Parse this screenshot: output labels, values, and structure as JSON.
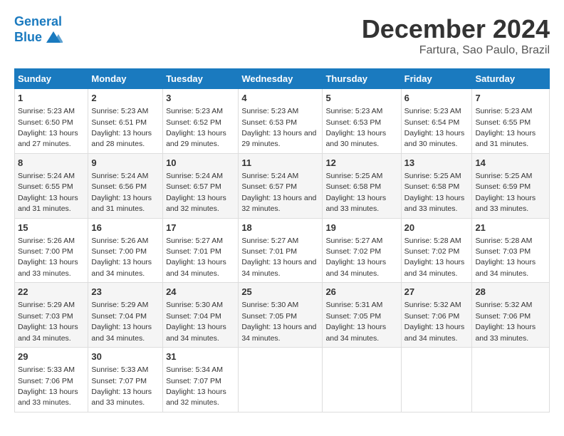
{
  "logo": {
    "line1": "General",
    "line2": "Blue"
  },
  "title": "December 2024",
  "subtitle": "Fartura, Sao Paulo, Brazil",
  "weekdays": [
    "Sunday",
    "Monday",
    "Tuesday",
    "Wednesday",
    "Thursday",
    "Friday",
    "Saturday"
  ],
  "weeks": [
    [
      {
        "day": 1,
        "sunrise": "5:23 AM",
        "sunset": "6:50 PM",
        "daylight": "13 hours and 27 minutes."
      },
      {
        "day": 2,
        "sunrise": "5:23 AM",
        "sunset": "6:51 PM",
        "daylight": "13 hours and 28 minutes."
      },
      {
        "day": 3,
        "sunrise": "5:23 AM",
        "sunset": "6:52 PM",
        "daylight": "13 hours and 29 minutes."
      },
      {
        "day": 4,
        "sunrise": "5:23 AM",
        "sunset": "6:53 PM",
        "daylight": "13 hours and 29 minutes."
      },
      {
        "day": 5,
        "sunrise": "5:23 AM",
        "sunset": "6:53 PM",
        "daylight": "13 hours and 30 minutes."
      },
      {
        "day": 6,
        "sunrise": "5:23 AM",
        "sunset": "6:54 PM",
        "daylight": "13 hours and 30 minutes."
      },
      {
        "day": 7,
        "sunrise": "5:23 AM",
        "sunset": "6:55 PM",
        "daylight": "13 hours and 31 minutes."
      }
    ],
    [
      {
        "day": 8,
        "sunrise": "5:24 AM",
        "sunset": "6:55 PM",
        "daylight": "13 hours and 31 minutes."
      },
      {
        "day": 9,
        "sunrise": "5:24 AM",
        "sunset": "6:56 PM",
        "daylight": "13 hours and 31 minutes."
      },
      {
        "day": 10,
        "sunrise": "5:24 AM",
        "sunset": "6:57 PM",
        "daylight": "13 hours and 32 minutes."
      },
      {
        "day": 11,
        "sunrise": "5:24 AM",
        "sunset": "6:57 PM",
        "daylight": "13 hours and 32 minutes."
      },
      {
        "day": 12,
        "sunrise": "5:25 AM",
        "sunset": "6:58 PM",
        "daylight": "13 hours and 33 minutes."
      },
      {
        "day": 13,
        "sunrise": "5:25 AM",
        "sunset": "6:58 PM",
        "daylight": "13 hours and 33 minutes."
      },
      {
        "day": 14,
        "sunrise": "5:25 AM",
        "sunset": "6:59 PM",
        "daylight": "13 hours and 33 minutes."
      }
    ],
    [
      {
        "day": 15,
        "sunrise": "5:26 AM",
        "sunset": "7:00 PM",
        "daylight": "13 hours and 33 minutes."
      },
      {
        "day": 16,
        "sunrise": "5:26 AM",
        "sunset": "7:00 PM",
        "daylight": "13 hours and 34 minutes."
      },
      {
        "day": 17,
        "sunrise": "5:27 AM",
        "sunset": "7:01 PM",
        "daylight": "13 hours and 34 minutes."
      },
      {
        "day": 18,
        "sunrise": "5:27 AM",
        "sunset": "7:01 PM",
        "daylight": "13 hours and 34 minutes."
      },
      {
        "day": 19,
        "sunrise": "5:27 AM",
        "sunset": "7:02 PM",
        "daylight": "13 hours and 34 minutes."
      },
      {
        "day": 20,
        "sunrise": "5:28 AM",
        "sunset": "7:02 PM",
        "daylight": "13 hours and 34 minutes."
      },
      {
        "day": 21,
        "sunrise": "5:28 AM",
        "sunset": "7:03 PM",
        "daylight": "13 hours and 34 minutes."
      }
    ],
    [
      {
        "day": 22,
        "sunrise": "5:29 AM",
        "sunset": "7:03 PM",
        "daylight": "13 hours and 34 minutes."
      },
      {
        "day": 23,
        "sunrise": "5:29 AM",
        "sunset": "7:04 PM",
        "daylight": "13 hours and 34 minutes."
      },
      {
        "day": 24,
        "sunrise": "5:30 AM",
        "sunset": "7:04 PM",
        "daylight": "13 hours and 34 minutes."
      },
      {
        "day": 25,
        "sunrise": "5:30 AM",
        "sunset": "7:05 PM",
        "daylight": "13 hours and 34 minutes."
      },
      {
        "day": 26,
        "sunrise": "5:31 AM",
        "sunset": "7:05 PM",
        "daylight": "13 hours and 34 minutes."
      },
      {
        "day": 27,
        "sunrise": "5:32 AM",
        "sunset": "7:06 PM",
        "daylight": "13 hours and 34 minutes."
      },
      {
        "day": 28,
        "sunrise": "5:32 AM",
        "sunset": "7:06 PM",
        "daylight": "13 hours and 33 minutes."
      }
    ],
    [
      {
        "day": 29,
        "sunrise": "5:33 AM",
        "sunset": "7:06 PM",
        "daylight": "13 hours and 33 minutes."
      },
      {
        "day": 30,
        "sunrise": "5:33 AM",
        "sunset": "7:07 PM",
        "daylight": "13 hours and 33 minutes."
      },
      {
        "day": 31,
        "sunrise": "5:34 AM",
        "sunset": "7:07 PM",
        "daylight": "13 hours and 32 minutes."
      },
      null,
      null,
      null,
      null
    ]
  ]
}
